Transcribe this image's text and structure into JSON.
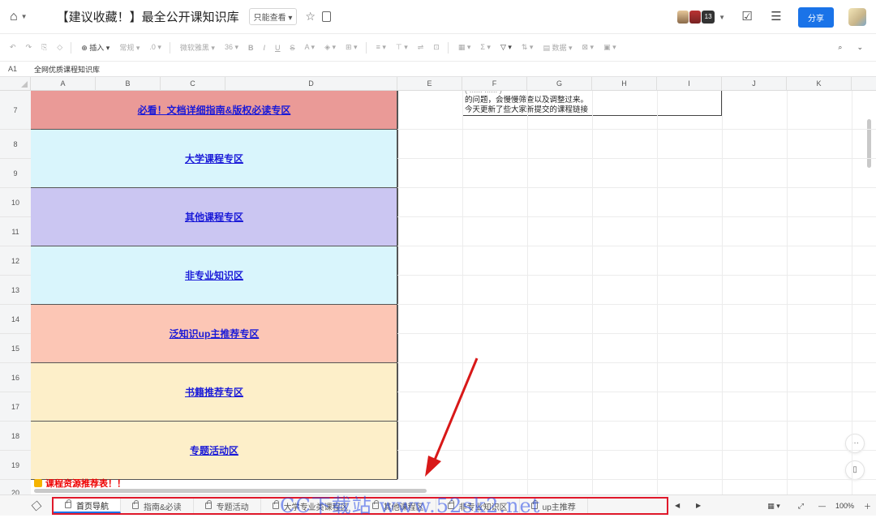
{
  "header": {
    "doc_title": "【建议收藏！】最全公开课知识库",
    "readonly_label": "只能查看",
    "avatar_badge": "13",
    "share_label": "分享"
  },
  "toolbar": {
    "insert_label": "插入",
    "format_label": "常规",
    "decimal_label": ".0",
    "font_label": "微软雅黑",
    "size_label": "36",
    "data_label": "数据"
  },
  "formula_bar": {
    "cell_ref": "A1",
    "value": "全网优质课程知识库"
  },
  "columns": [
    "A",
    "B",
    "C",
    "D",
    "E",
    "F",
    "G",
    "H",
    "I",
    "J",
    "K"
  ],
  "rows": [
    "7",
    "8",
    "9",
    "10",
    "11",
    "12",
    "13",
    "14",
    "15",
    "16",
    "17",
    "18",
    "19",
    "20"
  ],
  "blocks": [
    {
      "label": "必看！文档详细指南&版权必读专区",
      "color": "#ea9a97"
    },
    {
      "label": "大学课程专区",
      "color": "#d9f5fc"
    },
    {
      "label": "其他课程专区",
      "color": "#cbc6f2"
    },
    {
      "label": "非专业知识区",
      "color": "#d9f5fc"
    },
    {
      "label": "泛知识up主推荐专区",
      "color": "#fcc6b5"
    },
    {
      "label": "书籍推荐专区",
      "color": "#fdefc9"
    },
    {
      "label": "专题活动区",
      "color": "#fdefc9"
    }
  ],
  "note": {
    "line1": "的问题，会慢慢筛查以及调整过来。",
    "line2": "今天更新了些大家新提交的课程链接"
  },
  "row20_text": "课程资源推荐表！！",
  "sheet_tabs": [
    {
      "label": "首页导航",
      "active": true
    },
    {
      "label": "指南&必读",
      "active": false
    },
    {
      "label": "专题活动",
      "active": false
    },
    {
      "label": "大学专业类课程区",
      "active": false
    },
    {
      "label": "其他课程区",
      "active": false
    },
    {
      "label": "非专业知识区",
      "active": false
    },
    {
      "label": "up主推荐",
      "active": false
    }
  ],
  "zoom": "100%",
  "watermark": "CC下载站 www.52sk2.net",
  "colors": {
    "accent": "#1a73e8",
    "highlight_box": "#e0192b",
    "link": "#1a1ad8"
  }
}
